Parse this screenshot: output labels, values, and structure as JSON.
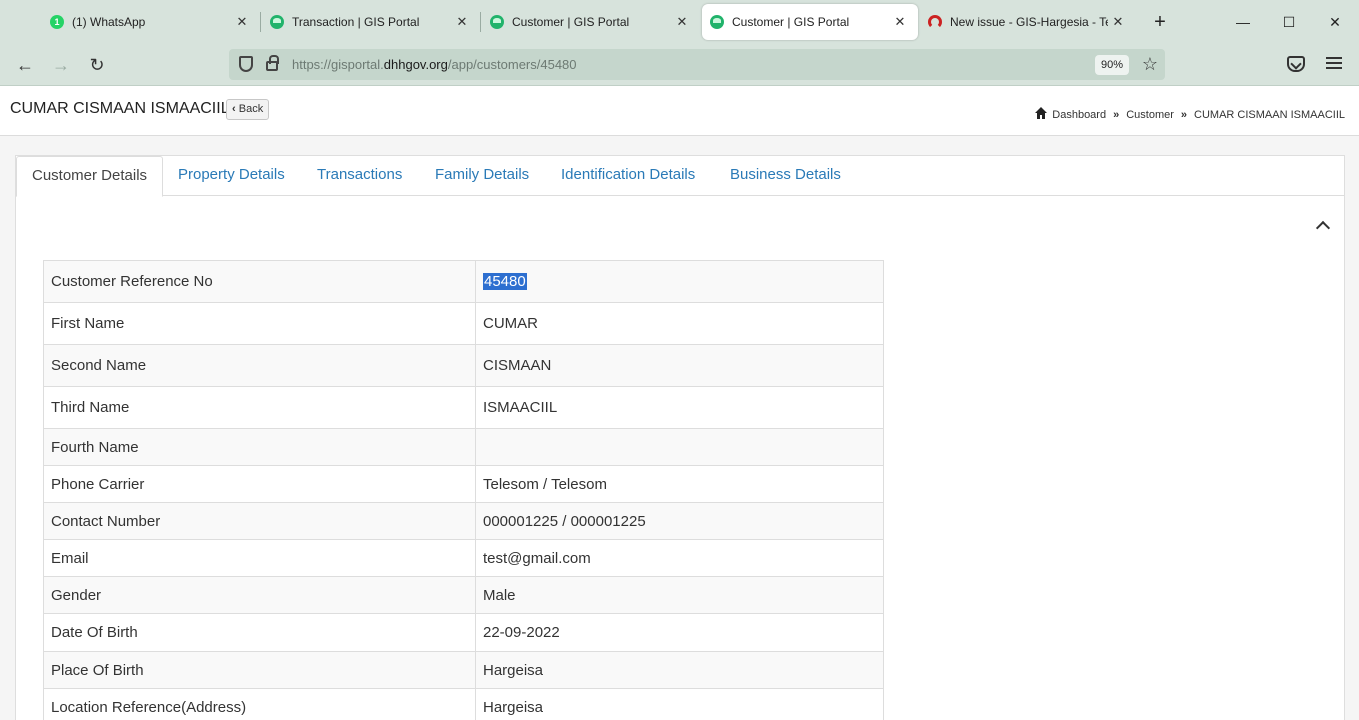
{
  "browser": {
    "tabs": [
      {
        "label": "(1) WhatsApp",
        "icon": "whatsapp-icon"
      },
      {
        "label": "Transaction | GIS Portal",
        "icon": "gis-portal-icon"
      },
      {
        "label": "Customer | GIS Portal",
        "icon": "gis-portal-icon"
      },
      {
        "label": "Customer | GIS Portal",
        "icon": "gis-portal-icon",
        "active": true
      },
      {
        "label": "New issue - GIS-Hargesia - Tea",
        "icon": "gitlab-icon"
      }
    ],
    "close_glyph": "✕",
    "new_tab_glyph": "+",
    "window_controls": {
      "minimize": "—",
      "maximize": "☐",
      "close": "✕"
    },
    "nav": {
      "back": "←",
      "forward": "→",
      "reload": "↻"
    },
    "url": {
      "prefix": "https://gisportal.",
      "host": "dhhgov.org",
      "path": "/app/customers/45480"
    },
    "zoom": "90%",
    "star_glyph": "☆"
  },
  "header": {
    "title": "CUMAR CISMAAN ISMAACIIL",
    "back_label": "Back",
    "back_icon": "‹",
    "breadcrumb": {
      "home": "Dashboard",
      "separator": "»",
      "items": [
        "Customer",
        "CUMAR CISMAAN ISMAACIIL"
      ]
    }
  },
  "tabs": [
    {
      "label": "Customer Details",
      "active": true
    },
    {
      "label": "Property Details"
    },
    {
      "label": "Transactions"
    },
    {
      "label": "Family Details"
    },
    {
      "label": "Identification Details"
    },
    {
      "label": "Business Details"
    }
  ],
  "details": [
    {
      "label": "Customer Reference No",
      "value": "45480"
    },
    {
      "label": "First Name",
      "value": "CUMAR"
    },
    {
      "label": "Second Name",
      "value": "CISMAAN"
    },
    {
      "label": "Third Name",
      "value": "ISMAACIIL"
    },
    {
      "label": "Fourth Name",
      "value": ""
    },
    {
      "label": "Phone Carrier",
      "value": "Telesom / Telesom"
    },
    {
      "label": "Contact Number",
      "value": "000001225 / 000001225"
    },
    {
      "label": "Email",
      "value": "test@gmail.com"
    },
    {
      "label": "Gender",
      "value": "Male"
    },
    {
      "label": "Date Of Birth",
      "value": "22-09-2022"
    },
    {
      "label": "Place Of Birth",
      "value": "Hargeisa"
    },
    {
      "label": "Location Reference(Address)",
      "value": "Hargeisa"
    }
  ],
  "colors": {
    "link": "#2a7ab7",
    "chrome": "#d7e3dc",
    "selection": "#2d6fd0"
  }
}
